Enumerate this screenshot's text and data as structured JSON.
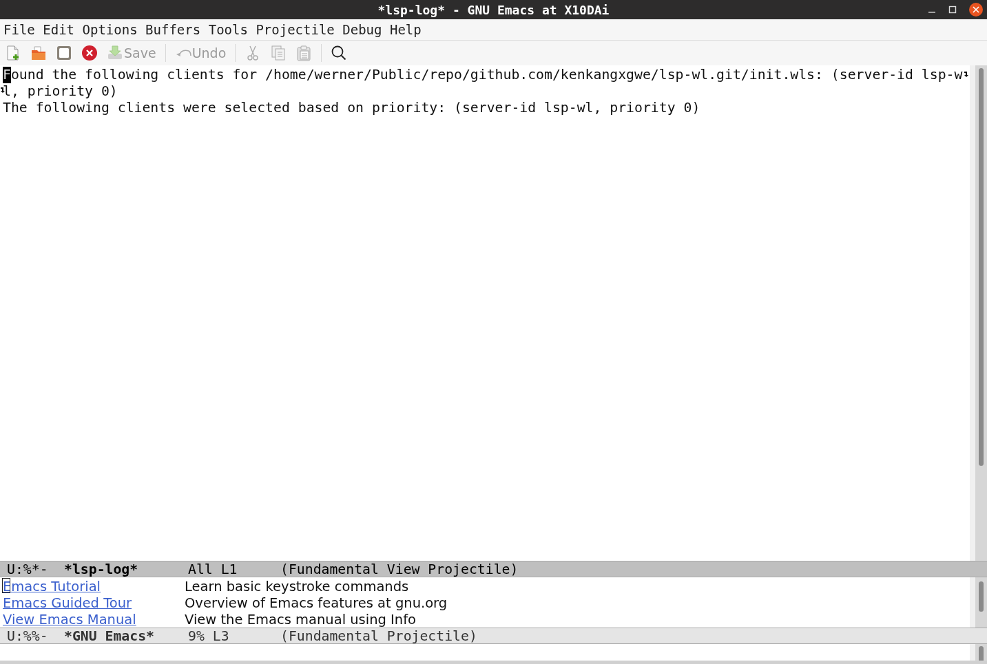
{
  "window": {
    "title": "*lsp-log* - GNU Emacs at X10DAi"
  },
  "menu": [
    "File",
    "Edit",
    "Options",
    "Buffers",
    "Tools",
    "Projectile",
    "Debug",
    "Help"
  ],
  "toolbar": [
    {
      "kind": "new-file",
      "disabled": false
    },
    {
      "kind": "open",
      "disabled": false
    },
    {
      "kind": "frame",
      "disabled": false
    },
    {
      "kind": "close",
      "disabled": false
    },
    {
      "kind": "save",
      "label": "Save",
      "disabled": true
    },
    {
      "kind": "separator"
    },
    {
      "kind": "undo",
      "label": "Undo",
      "disabled": true
    },
    {
      "kind": "separator"
    },
    {
      "kind": "cut",
      "disabled": true
    },
    {
      "kind": "copy",
      "disabled": true
    },
    {
      "kind": "paste",
      "disabled": true
    },
    {
      "kind": "separator"
    },
    {
      "kind": "search",
      "disabled": false
    }
  ],
  "windows": [
    {
      "active": true,
      "kind": "text",
      "lines": [
        {
          "text": "Found the following clients for /home/werner/Public/repo/github.com/kenkangxgwe/lsp-wl.git/init.wls: (server-id lsp-w",
          "cursor": true,
          "continues": true
        },
        {
          "text": "l, priority 0)",
          "cursor": false,
          "continues": false
        },
        {
          "text": "The following clients were selected based on priority: (server-id lsp-wl, priority 0)",
          "cursor": false,
          "continues": false
        }
      ],
      "mode_line": {
        "status": "U:%*-",
        "buffer": "*lsp-log*",
        "position": "All L1",
        "modes": "(Fundamental View Projectile)"
      }
    },
    {
      "active": false,
      "kind": "links",
      "rows": [
        {
          "link": "Emacs Tutorial",
          "description": "Learn basic keystroke commands",
          "cursor": true
        },
        {
          "link": "Emacs Guided Tour",
          "description": "Overview of Emacs features at gnu.org",
          "cursor": false
        },
        {
          "link": "View Emacs Manual",
          "description": "View the Emacs manual using Info",
          "cursor": false
        }
      ],
      "mode_line": {
        "status": "U:%%-",
        "buffer": "*GNU Emacs*",
        "position": "9% L3",
        "modes": "(Fundamental Projectile)"
      }
    }
  ]
}
